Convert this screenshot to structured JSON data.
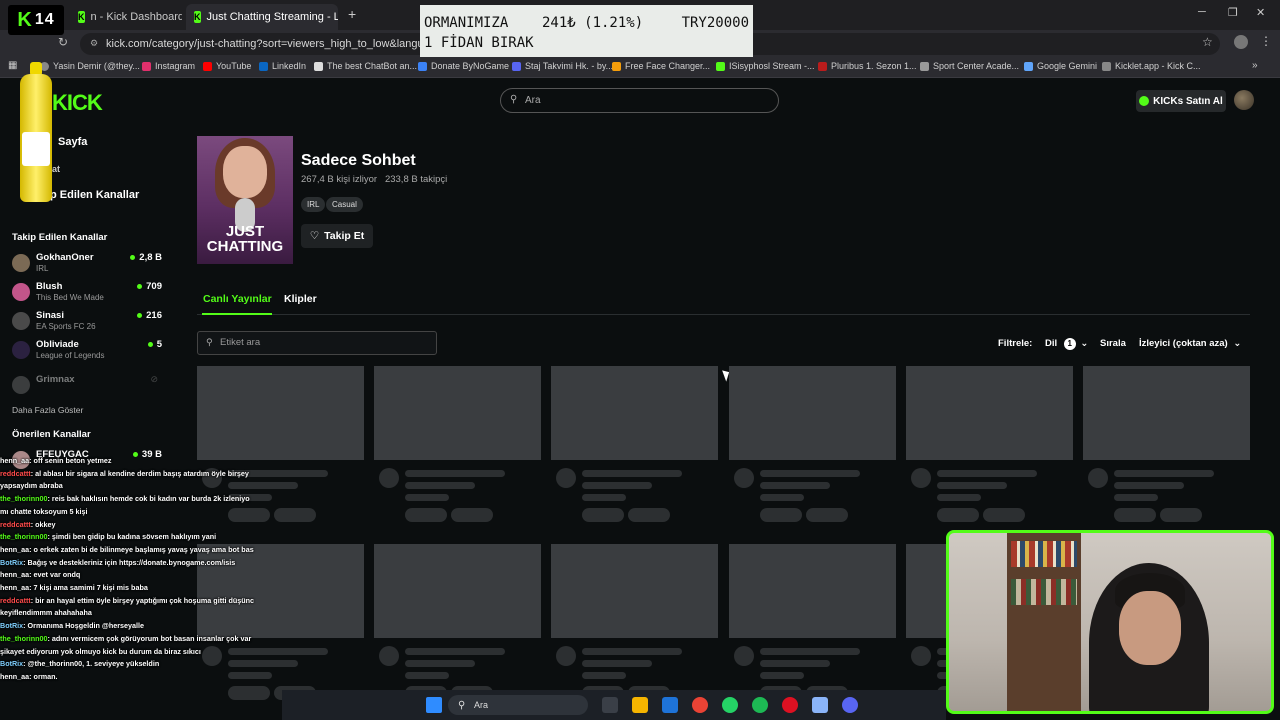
{
  "browser": {
    "tabs": [
      {
        "label": "n - Kick Dashboard"
      },
      {
        "label": "Just Chatting Streaming - Live"
      }
    ],
    "new_tab": "+",
    "url": "kick.com/category/just-chatting?sort=viewers_high_to_low&languages=tr",
    "bookmarks": [
      "Yasin Demir (@they...",
      "Instagram",
      "YouTube",
      "LinkedIn",
      "The best ChatBot an...",
      "Donate ByNoGame",
      "Staj Takvimi Hk. - by...",
      "Free Face Changer...",
      "ISisyphosl Stream -...",
      "Pluribus 1. Sezon 1...",
      "Sport Center Acade...",
      "Google Gemini",
      "Kicklet.app - Kick C..."
    ]
  },
  "overlay": {
    "logo_k": "K",
    "logo_num": "14",
    "donate_line1_a": "ORMANIMIZA",
    "donate_line1_b": "241₺ (1.21%)",
    "donate_line1_c": "TRY20000",
    "donate_line2": "1 FİDAN BIRAK"
  },
  "header": {
    "search_placeholder": "Ara",
    "kicks_button": "KICKs Satın Al",
    "logo": "KICK"
  },
  "sidebar": {
    "home": "Sayfa",
    "dashboard": "at",
    "following_link": "p Edilen Kanallar",
    "following_title": "Takip Edilen Kanallar",
    "channels": [
      {
        "name": "GokhanOner",
        "category": "IRL",
        "viewers": "2,8 B"
      },
      {
        "name": "Blush",
        "category": "This Bed We Made",
        "viewers": "709"
      },
      {
        "name": "Sinasi",
        "category": "EA Sports FC 26",
        "viewers": "216"
      },
      {
        "name": "Obliviade",
        "category": "League of Legends",
        "viewers": "5"
      },
      {
        "name": "Grimnax",
        "category": "",
        "viewers": ""
      }
    ],
    "show_more": "Daha Fazla Göster",
    "recommended_title": "Önerilen Kanallar",
    "recommended_first": {
      "name": "EFEUYGAC",
      "viewers": "39 B"
    }
  },
  "category": {
    "image_text": "JUST CHATTING",
    "title": "Sadece Sohbet",
    "viewers": "267,4 B kişi izliyor",
    "followers": "233,8 B takipçi",
    "tags": [
      "IRL",
      "Casual"
    ],
    "follow": "Takip Et"
  },
  "tabs": {
    "live": "Canlı Yayınlar",
    "clips": "Klipler"
  },
  "filters": {
    "tag_search_placeholder": "Etiket ara",
    "filter_label": "Filtrele:",
    "language": "Dil",
    "language_count": "1",
    "sort_label": "Sırala",
    "sort_value": "İzleyici (çoktan aza)"
  },
  "chat": [
    {
      "user": "henn_aa",
      "text": ": off senin beton yetmez",
      "c": "u3"
    },
    {
      "user": "reddcattt",
      "text": ": al ablası bir sigara al kendine derdim başış atardım öyle birşey",
      "c": "u2"
    },
    {
      "user": "",
      "text": "yapsaydım abraba",
      "c": "u3"
    },
    {
      "user": "the_thorinn00",
      "text": ": reis bak haklısın hemde cok bi kadın var burda 2k izleniyo",
      "c": "u1"
    },
    {
      "user": "",
      "text": "mı chatte toksoyum 5 kişi",
      "c": "u3"
    },
    {
      "user": "reddcattt",
      "text": ": okkey",
      "c": "u2"
    },
    {
      "user": "the_thorinn00",
      "text": ": şimdi ben gidip bu kadına sövsem haklıyım yani",
      "c": "u1"
    },
    {
      "user": "henn_aa",
      "text": ": o erkek zaten bi de bilinmeye başlamış yavaş yavaş ama bot bas",
      "c": "u3"
    },
    {
      "user": "BotRix",
      "text": ": Bağış ve destekleriniz için https://donate.bynogame.com/isis",
      "c": "u4"
    },
    {
      "user": "henn_aa",
      "text": ": evet var ondq",
      "c": "u3"
    },
    {
      "user": "henn_aa",
      "text": ": 7 kişi ama samimi 7 kişi mis baba",
      "c": "u3"
    },
    {
      "user": "reddcattt",
      "text": ": bir an hayal ettim öyle birşey yaptığımı çok hoşuma gitti düşünc",
      "c": "u2"
    },
    {
      "user": "",
      "text": "keyiflendimmm ahahahaha",
      "c": "u3"
    },
    {
      "user": "BotRix",
      "text": ": Ormanıma Hoşgeldin @herseyalle",
      "c": "u4"
    },
    {
      "user": "the_thorinn00",
      "text": ": adını vermicem çok görüyorum bot basan insanlar çok var",
      "c": "u1"
    },
    {
      "user": "",
      "text": "şikayet ediyorum yok olmuyo kick bu durum da biraz sıkıcı",
      "c": "u3"
    },
    {
      "user": "BotRix",
      "text": ": @the_thorinn00, 1. seviyeye yükseldin",
      "c": "u4"
    },
    {
      "user": "henn_aa",
      "text": ": orman.",
      "c": "u3"
    }
  ],
  "taskbar": {
    "search": "Ara"
  }
}
